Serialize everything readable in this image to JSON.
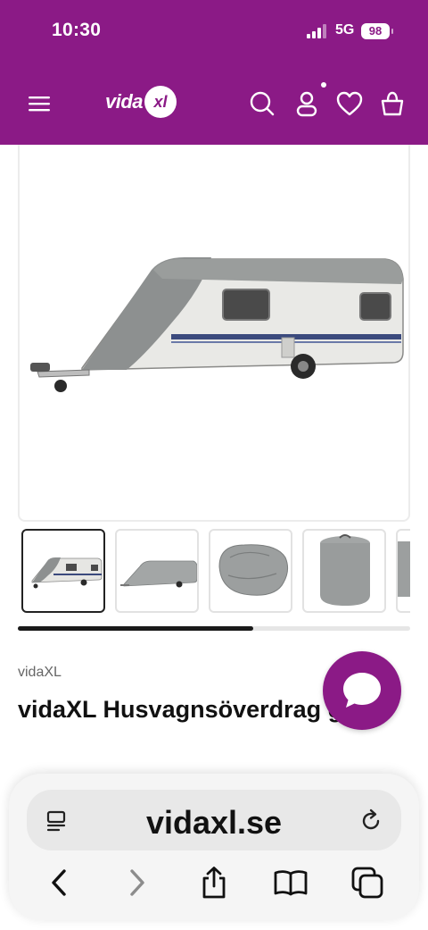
{
  "status_bar": {
    "time": "10:30",
    "network": "5G",
    "battery": "98"
  },
  "nav": {
    "logo_text": "vida",
    "logo_badge": "xl",
    "icons": [
      "menu-icon",
      "search-icon",
      "account-icon",
      "wishlist-icon",
      "cart-icon"
    ]
  },
  "product": {
    "brand": "vidaXL",
    "title": "vidaXL Husvagnsöverdrag grå",
    "thumbnail_count": 5,
    "active_thumbnail": 1,
    "gallery_scroll_fraction": 0.6
  },
  "browser": {
    "url": "vidaxl.se",
    "tools": [
      "back-icon",
      "forward-icon",
      "share-icon",
      "bookmarks-icon",
      "tabs-icon"
    ]
  },
  "colors": {
    "brand": "#8b1a86",
    "text": "#111111",
    "muted": "#666666"
  }
}
